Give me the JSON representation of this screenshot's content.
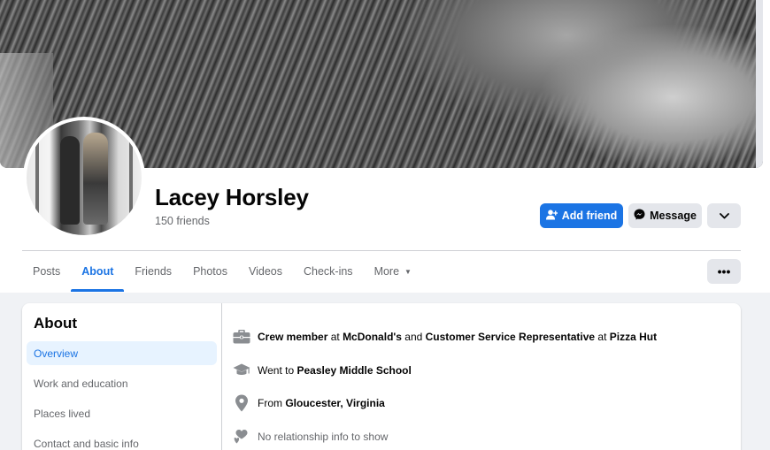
{
  "profile": {
    "name": "Lacey Horsley",
    "friends": "150 friends"
  },
  "actions": {
    "add_friend": "Add friend",
    "message": "Message",
    "more_icon": "chevron-down-icon"
  },
  "tabs": [
    {
      "label": "Posts",
      "active": false
    },
    {
      "label": "About",
      "active": true
    },
    {
      "label": "Friends",
      "active": false
    },
    {
      "label": "Photos",
      "active": false
    },
    {
      "label": "Videos",
      "active": false
    },
    {
      "label": "Check-ins",
      "active": false
    },
    {
      "label": "More",
      "active": false
    }
  ],
  "tab_menu_label": "•••",
  "about": {
    "title": "About",
    "sidebar": [
      {
        "label": "Overview",
        "active": true
      },
      {
        "label": "Work and education",
        "active": false
      },
      {
        "label": "Places lived",
        "active": false
      },
      {
        "label": "Contact and basic info",
        "active": false
      }
    ],
    "work": {
      "role1": "Crew member",
      "at1": " at ",
      "company1": "McDonald's",
      "and": " and ",
      "role2": "Customer Service Representative",
      "at2": " at ",
      "company2": "Pizza Hut"
    },
    "education": {
      "prefix": "Went to ",
      "school": "Peasley Middle School"
    },
    "hometown": {
      "prefix": "From ",
      "place": "Gloucester, Virginia"
    },
    "relationship": "No relationship info to show"
  },
  "colors": {
    "accent": "#1b74e4",
    "secondary_button": "#e4e6eb",
    "page_background": "#f0f2f5",
    "muted_text": "#65676b"
  }
}
